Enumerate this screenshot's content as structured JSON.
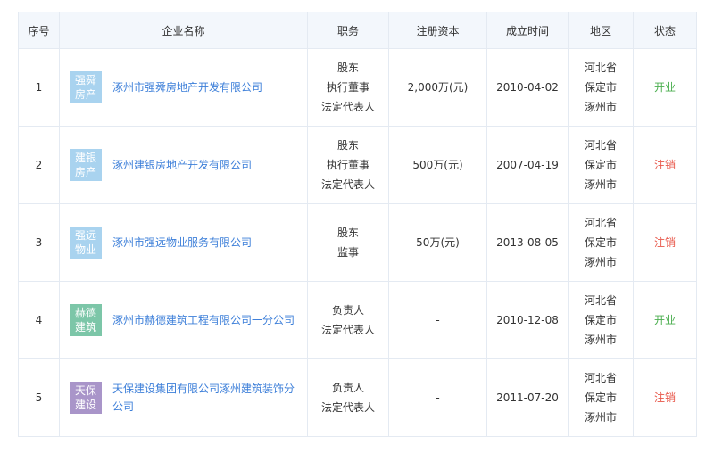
{
  "headers": {
    "index": "序号",
    "name": "企业名称",
    "role": "职务",
    "capital": "注册资本",
    "date": "成立时间",
    "region": "地区",
    "status": "状态"
  },
  "colors": {
    "link": "#3d7fd9",
    "status_open": "#4caf50",
    "status_closed": "#e8574a",
    "header_bg": "#f3f7fc",
    "border": "#e4eaf2"
  },
  "rows": [
    {
      "index": "1",
      "logo_line1": "强舜",
      "logo_line2": "房产",
      "logo_color": "#a9d3ef",
      "name": "涿州市强舜房地产开发有限公司",
      "roles": [
        "股东",
        "执行董事",
        "法定代表人"
      ],
      "capital": "2,000万(元)",
      "date": "2010-04-02",
      "region": [
        "河北省",
        "保定市",
        "涿州市"
      ],
      "status": "开业",
      "status_type": "open"
    },
    {
      "index": "2",
      "logo_line1": "建银",
      "logo_line2": "房产",
      "logo_color": "#a9d3ef",
      "name": "涿州建银房地产开发有限公司",
      "roles": [
        "股东",
        "执行董事",
        "法定代表人"
      ],
      "capital": "500万(元)",
      "date": "2007-04-19",
      "region": [
        "河北省",
        "保定市",
        "涿州市"
      ],
      "status": "注销",
      "status_type": "closed"
    },
    {
      "index": "3",
      "logo_line1": "强远",
      "logo_line2": "物业",
      "logo_color": "#a9d3ef",
      "name": "涿州市强远物业服务有限公司",
      "roles": [
        "股东",
        "监事"
      ],
      "capital": "50万(元)",
      "date": "2013-08-05",
      "region": [
        "河北省",
        "保定市",
        "涿州市"
      ],
      "status": "注销",
      "status_type": "closed"
    },
    {
      "index": "4",
      "logo_line1": "赫德",
      "logo_line2": "建筑",
      "logo_color": "#7cc6a8",
      "name": "涿州市赫德建筑工程有限公司一分公司",
      "roles": [
        "负责人",
        "法定代表人"
      ],
      "capital": "-",
      "date": "2010-12-08",
      "region": [
        "河北省",
        "保定市",
        "涿州市"
      ],
      "status": "开业",
      "status_type": "open"
    },
    {
      "index": "5",
      "logo_line1": "天保",
      "logo_line2": "建设",
      "logo_color": "#a995c9",
      "name": "天保建设集团有限公司涿州建筑装饰分公司",
      "roles": [
        "负责人",
        "法定代表人"
      ],
      "capital": "-",
      "date": "2011-07-20",
      "region": [
        "河北省",
        "保定市",
        "涿州市"
      ],
      "status": "注销",
      "status_type": "closed"
    }
  ]
}
